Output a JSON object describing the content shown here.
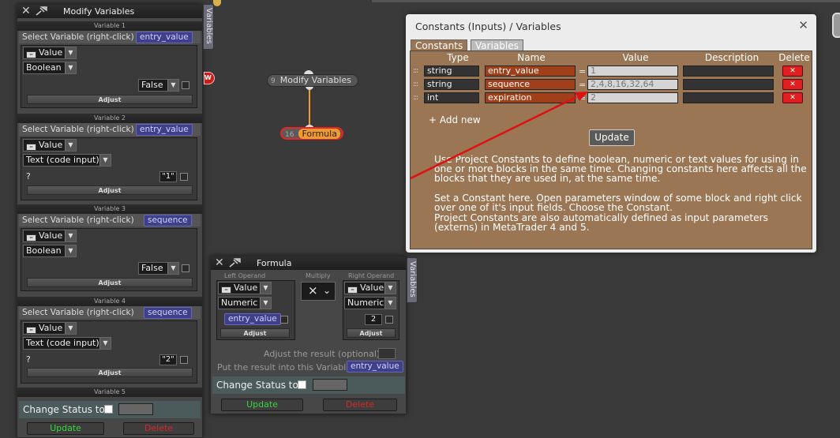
{
  "left_panel": {
    "title": "Modify Variables",
    "side_tab": "Variables",
    "select_label": "Select Variable (right-click)",
    "adjust_label": "Adjust",
    "sections": [
      {
        "header": "Variable 1",
        "variable": "entry_value",
        "source": "Value",
        "type": "Boolean",
        "value": "False"
      },
      {
        "header": "Variable 2",
        "variable": "entry_value",
        "source": "Value",
        "type": "Text (code input)",
        "prefix": "?",
        "value": "\"1\""
      },
      {
        "header": "Variable 3",
        "variable": "sequence",
        "source": "Value",
        "type": "Boolean",
        "value": "False"
      },
      {
        "header": "Variable 4",
        "variable": "sequence",
        "source": "Value",
        "type": "Text (code input)",
        "prefix": "?",
        "value": "\"2\""
      }
    ],
    "section5_header": "Variable 5",
    "change_status_label": "Change Status to",
    "update_label": "Update",
    "delete_label": "Delete"
  },
  "nodes": [
    {
      "number": "9",
      "label": "Modify Variables"
    },
    {
      "number": "16",
      "label": "Formula"
    }
  ],
  "formula_panel": {
    "title": "Formula",
    "side_tab": "Variables",
    "left_operand_label": "Left Operand",
    "multiply_label": "Multiply",
    "right_operand_label": "Right Operand",
    "left_source": "Value",
    "left_type": "Numeric",
    "left_variable": "entry_value",
    "operator": "×",
    "right_source": "Value",
    "right_type": "Numeric",
    "right_value": "2",
    "adjust_label": "Adjust",
    "adjust_result_label": "Adjust the result (optional):",
    "put_result_label": "Put the result into this Variable:",
    "result_variable": "entry_value",
    "change_status_label": "Change Status to",
    "update_label": "Update",
    "delete_label": "Delete"
  },
  "constants_panel": {
    "title": "Constants (Inputs) / Variables",
    "tabs": [
      "Constants",
      "Variables"
    ],
    "columns": [
      "Type",
      "Name",
      "Value",
      "Description",
      "Delete"
    ],
    "rows": [
      {
        "type": "string",
        "name": "entry_value",
        "value": "1",
        "description": ""
      },
      {
        "type": "string",
        "name": "sequence",
        "value": "2,4,8,16,32,64",
        "description": ""
      },
      {
        "type": "int",
        "name": "expiration",
        "value": "2",
        "description": ""
      }
    ],
    "add_new_label": "+ Add new",
    "update_label": "Update",
    "help_paragraph_1": [
      "Use Project Constants to define boolean, numeric or text values for using in",
      "one or more blocks in the same time. Changing constants here affects all the",
      "blocks that they are used in, at the same time."
    ],
    "help_paragraph_2": [
      "Set a Constant here. Open parameters window of some block and right click",
      "over one of it's input fields. Choose the Constant.",
      "Project Constants are also automatically defined as input parameters",
      "(externs) in MetaTrader 4 and 5."
    ]
  },
  "colors": {
    "accent_orange": "#f29a2e",
    "arrow_red": "#e01010",
    "var_pill": "#3f3f8a",
    "constants_bg": "#9a7654"
  }
}
